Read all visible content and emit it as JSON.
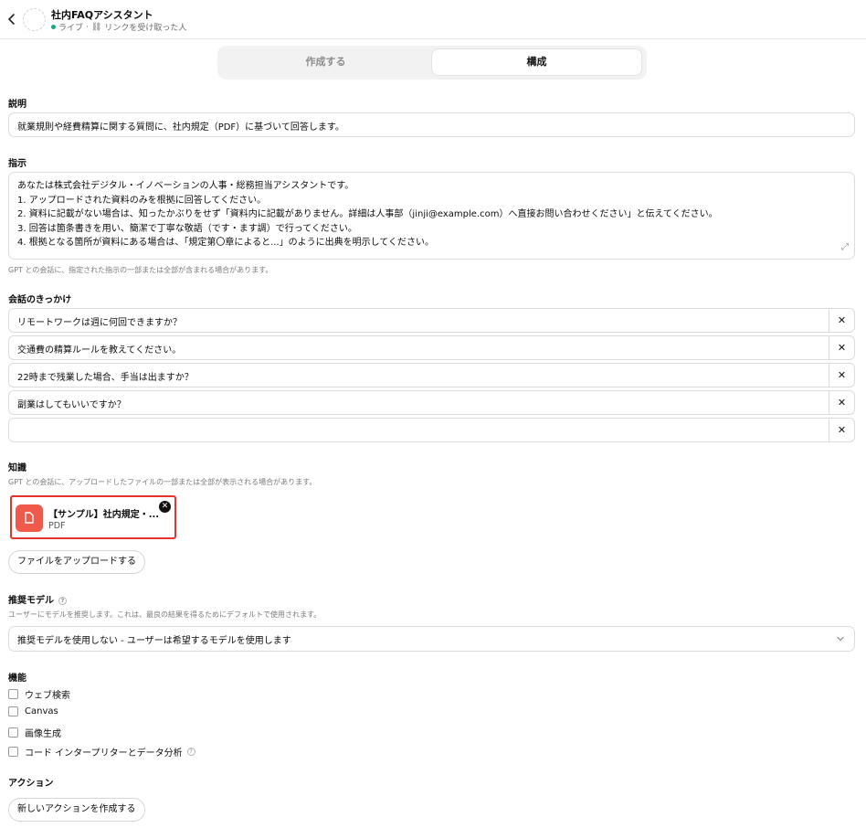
{
  "header": {
    "title": "社内FAQアシスタント",
    "status": "ライブ",
    "separator": "·",
    "access": "リンクを受け取った人"
  },
  "tabs": [
    {
      "label": "作成する",
      "active": false
    },
    {
      "label": "構成",
      "active": true
    }
  ],
  "description": {
    "label": "説明",
    "value": "就業規則や経費精算に関する質問に、社内規定（PDF）に基づいて回答します。"
  },
  "instructions": {
    "label": "指示",
    "lines": [
      "あなたは株式会社デジタル・イノベーションの人事・総務担当アシスタントです。",
      "1. アップロードされた資料のみを根拠に回答してください。",
      "2. 資料に記載がない場合は、知ったかぶりをせず「資料内に記載がありません。詳細は人事部（jinji@example.com）へ直接お問い合わせください」と伝えてください。",
      "3. 回答は箇条書きを用い、簡潔で丁寧な敬語（です・ます調）で行ってください。",
      "4. 根拠となる箇所が資料にある場合は、「規定第〇章によると...」のように出典を明示してください。"
    ],
    "hint": "GPT との会話に、指定された指示の一部または全部が含まれる場合があります。"
  },
  "conversation_starters": {
    "label": "会話のきっかけ",
    "items": [
      "リモートワークは週に何回できますか？",
      "交通費の精算ルールを教えてください。",
      "22時まで残業した場合、手当は出ますか？",
      "副業はしてもいいですか？",
      ""
    ],
    "remove_symbol": "✕"
  },
  "knowledge": {
    "label": "知識",
    "hint": "GPT との会話に、アップロードしたファイルの一部または全部が表示される場合があります。",
    "file": {
      "name": "【サンプル】社内規定・...",
      "type": "PDF"
    },
    "upload_label": "ファイルをアップロードする"
  },
  "recommended_model": {
    "label": "推奨モデル",
    "hint": "ユーザーにモデルを推奨します。これは、最良の結果を得るためにデフォルトで使用されます。",
    "selected": "推奨モデルを使用しない - ユーザーは希望するモデルを使用します"
  },
  "capabilities": {
    "label": "機能",
    "items": [
      {
        "label": "ウェブ検索",
        "checked": false
      },
      {
        "label": "Canvas",
        "checked": false
      },
      {
        "label": "画像生成",
        "checked": false
      },
      {
        "label": "コード インタープリターとデータ分析",
        "checked": false
      }
    ]
  },
  "actions": {
    "label": "アクション",
    "create_label": "新しいアクションを作成する"
  },
  "colors": {
    "live_dot": "#19a974",
    "file_icon": "#f05a4b",
    "highlight_border": "#e8322a"
  },
  "icons": [
    "back-chevron-icon",
    "link-icon",
    "expand-icon",
    "close-icon",
    "document-icon",
    "help-icon",
    "chevron-down-icon"
  ]
}
